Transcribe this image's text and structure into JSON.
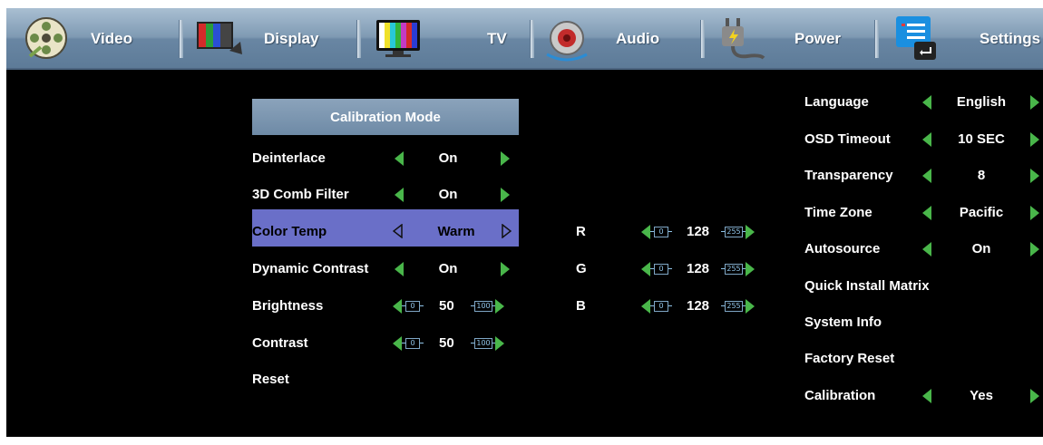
{
  "tabs": [
    {
      "label": "Video",
      "icon": "film-reel-icon"
    },
    {
      "label": "Display",
      "icon": "color-bars-icon"
    },
    {
      "label": "TV",
      "icon": "tv-icon"
    },
    {
      "label": "Audio",
      "icon": "speaker-icon"
    },
    {
      "label": "Power",
      "icon": "power-plug-icon"
    },
    {
      "label": "Settings",
      "icon": "settings-list-icon"
    }
  ],
  "video": {
    "header": "Calibration Mode",
    "items": [
      {
        "label": "Deinterlace",
        "value": "On"
      },
      {
        "label": "3D Comb Filter",
        "value": "On"
      },
      {
        "label": "Color Temp",
        "value": "Warm",
        "selected": true
      },
      {
        "label": "Dynamic Contrast",
        "value": "On"
      },
      {
        "label": "Brightness",
        "slider": {
          "min": "0",
          "value": "50",
          "max": "100"
        }
      },
      {
        "label": "Contrast",
        "slider": {
          "min": "0",
          "value": "50",
          "max": "100"
        }
      },
      {
        "label": "Reset"
      }
    ]
  },
  "rgb": [
    {
      "label": "R",
      "min": "0",
      "value": "128",
      "max": "255"
    },
    {
      "label": "G",
      "min": "0",
      "value": "128",
      "max": "255"
    },
    {
      "label": "B",
      "min": "0",
      "value": "128",
      "max": "255"
    }
  ],
  "settings": [
    {
      "label": "Language",
      "value": "English"
    },
    {
      "label": "OSD Timeout",
      "value": "10 SEC"
    },
    {
      "label": "Transparency",
      "value": "8"
    },
    {
      "label": "Time Zone",
      "value": "Pacific"
    },
    {
      "label": "Autosource",
      "value": "On"
    },
    {
      "label": "Quick Install Matrix"
    },
    {
      "label": "System Info"
    },
    {
      "label": "Factory Reset"
    },
    {
      "label": "Calibration",
      "value": "Yes"
    }
  ],
  "colors": {
    "accent_green": "#49b64a",
    "highlight": "#6a6fc8",
    "tabbar": "#7f9ab3"
  }
}
